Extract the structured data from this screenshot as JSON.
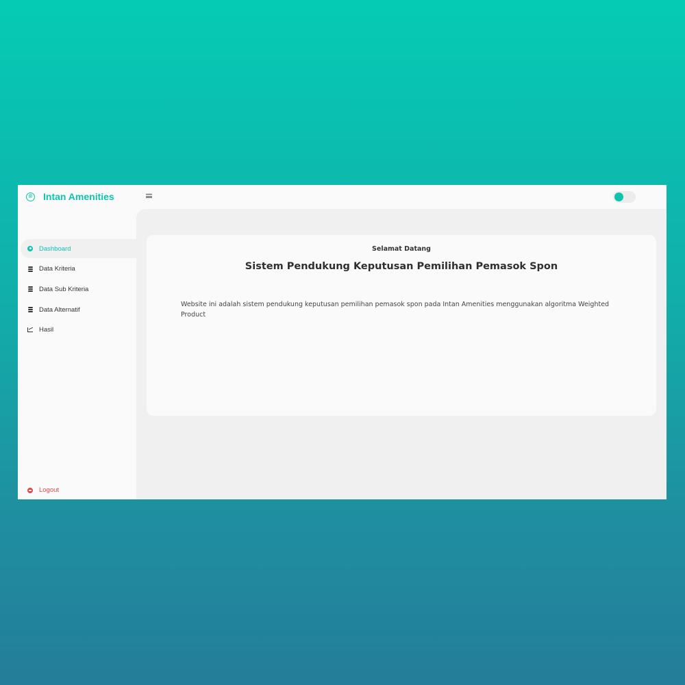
{
  "app": {
    "brand_name": "Intan Amenities",
    "brand_icon": "®",
    "accent_color": "#0fc3ad",
    "logout_color": "#e04848"
  },
  "topbar": {
    "menu_icon": "hamburger-menu-icon",
    "theme_toggle": "on"
  },
  "sidebar": {
    "items": [
      {
        "label": "Dashboard",
        "icon": "user-circle-icon",
        "active": true
      },
      {
        "label": "Data Kriteria",
        "icon": "database-icon",
        "active": false
      },
      {
        "label": "Data Sub Kriteria",
        "icon": "database-icon",
        "active": false
      },
      {
        "label": "Data Alternatif",
        "icon": "database-icon",
        "active": false
      },
      {
        "label": "Hasil",
        "icon": "chart-line-icon",
        "active": false
      }
    ],
    "logout": {
      "label": "Logout",
      "icon": "logout-icon"
    }
  },
  "main": {
    "greeting": "Selamat Datang",
    "title": "Sistem Pendukung Keputusan Pemilihan Pemasok Spon",
    "description": "Website ini adalah sistem pendukung keputusan pemilihan pemasok spon pada Intan Amenities menggunakan algoritma Weighted Product"
  }
}
